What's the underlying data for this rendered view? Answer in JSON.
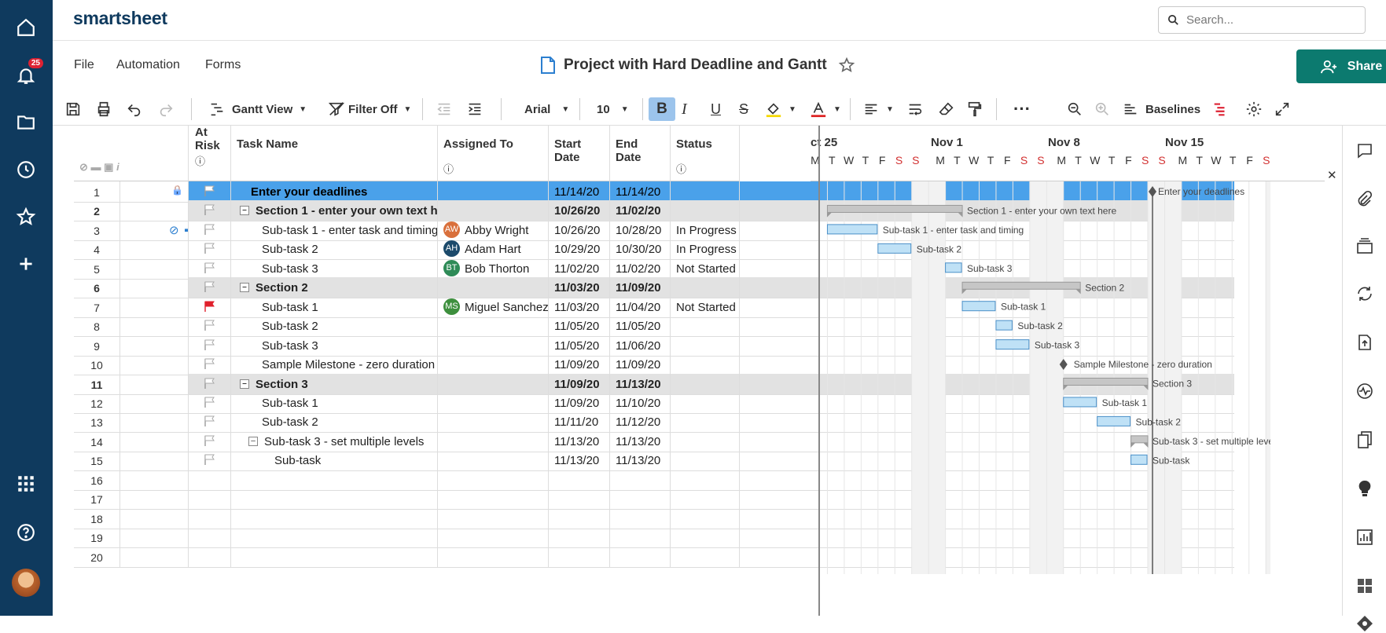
{
  "app": {
    "logo": "smartsheet",
    "notif_count": "25",
    "search_placeholder": "Search..."
  },
  "menu": {
    "file": "File",
    "automation": "Automation",
    "forms": "Forms"
  },
  "doc": {
    "title": "Project with Hard Deadline and Gantt",
    "share": "Share"
  },
  "toolbar": {
    "view": "Gantt View",
    "filter": "Filter Off",
    "font": "Arial",
    "size": "10",
    "baselines": "Baselines"
  },
  "columns": {
    "risk": "At Risk",
    "task": "Task Name",
    "assigned": "Assigned To",
    "start": "Start Date",
    "end": "End Date",
    "status": "Status"
  },
  "gantt": {
    "weeks": [
      "ct 25",
      "Nov 1",
      "Nov 8",
      "Nov 15"
    ],
    "days": [
      "M",
      "T",
      "W",
      "T",
      "F",
      "S",
      "S",
      "M",
      "T",
      "W",
      "T",
      "F",
      "S",
      "S",
      "M",
      "T",
      "W",
      "T",
      "F",
      "S",
      "S",
      "M",
      "T",
      "W",
      "T",
      "F",
      "S"
    ]
  },
  "rows": [
    {
      "n": "1",
      "task": "Enter your deadlines",
      "asg": "",
      "ini": "",
      "st": "11/14/20",
      "en": "11/14/20",
      "stat": "",
      "type": "sel",
      "indent": 0,
      "flag": "white",
      "lock": true
    },
    {
      "n": "2",
      "task": "Section 1 - enter your own text here",
      "asg": "",
      "ini": "",
      "st": "10/26/20",
      "en": "11/02/20",
      "stat": "",
      "type": "sec",
      "indent": 0,
      "flag": "grey"
    },
    {
      "n": "3",
      "task": "Sub-task 1 - enter task and timing",
      "asg": "Abby Wright",
      "ini": "AW",
      "st": "10/26/20",
      "en": "10/28/20",
      "stat": "In Progress",
      "type": "",
      "indent": 1,
      "flag": "grey",
      "icons": true
    },
    {
      "n": "4",
      "task": "Sub-task 2",
      "asg": "Adam Hart",
      "ini": "AH",
      "st": "10/29/20",
      "en": "10/30/20",
      "stat": "In Progress",
      "type": "",
      "indent": 1,
      "flag": "grey"
    },
    {
      "n": "5",
      "task": "Sub-task 3",
      "asg": "Bob Thorton",
      "ini": "BT",
      "st": "11/02/20",
      "en": "11/02/20",
      "stat": "Not Started",
      "type": "",
      "indent": 1,
      "flag": "grey"
    },
    {
      "n": "6",
      "task": "Section 2",
      "asg": "",
      "ini": "",
      "st": "11/03/20",
      "en": "11/09/20",
      "stat": "",
      "type": "sec",
      "indent": 0,
      "flag": "grey"
    },
    {
      "n": "7",
      "task": "Sub-task 1",
      "asg": "Miguel Sanchez",
      "ini": "MS",
      "st": "11/03/20",
      "en": "11/04/20",
      "stat": "Not Started",
      "type": "",
      "indent": 1,
      "flag": "red"
    },
    {
      "n": "8",
      "task": "Sub-task 2",
      "asg": "",
      "ini": "",
      "st": "11/05/20",
      "en": "11/05/20",
      "stat": "",
      "type": "",
      "indent": 1,
      "flag": "grey"
    },
    {
      "n": "9",
      "task": "Sub-task 3",
      "asg": "",
      "ini": "",
      "st": "11/05/20",
      "en": "11/06/20",
      "stat": "",
      "type": "",
      "indent": 1,
      "flag": "grey"
    },
    {
      "n": "10",
      "task": "Sample Milestone - zero duration",
      "asg": "",
      "ini": "",
      "st": "11/09/20",
      "en": "11/09/20",
      "stat": "",
      "type": "",
      "indent": 1,
      "flag": "grey"
    },
    {
      "n": "11",
      "task": "Section 3",
      "asg": "",
      "ini": "",
      "st": "11/09/20",
      "en": "11/13/20",
      "stat": "",
      "type": "sec",
      "indent": 0,
      "flag": "grey"
    },
    {
      "n": "12",
      "task": "Sub-task 1",
      "asg": "",
      "ini": "",
      "st": "11/09/20",
      "en": "11/10/20",
      "stat": "",
      "type": "",
      "indent": 1,
      "flag": "grey"
    },
    {
      "n": "13",
      "task": "Sub-task 2",
      "asg": "",
      "ini": "",
      "st": "11/11/20",
      "en": "11/12/20",
      "stat": "",
      "type": "",
      "indent": 1,
      "flag": "grey"
    },
    {
      "n": "14",
      "task": "Sub-task 3 - set multiple levels",
      "asg": "",
      "ini": "",
      "st": "11/13/20",
      "en": "11/13/20",
      "stat": "",
      "type": "",
      "indent": 1,
      "flag": "grey",
      "collapsible": true
    },
    {
      "n": "15",
      "task": "Sub-task",
      "asg": "",
      "ini": "",
      "st": "11/13/20",
      "en": "11/13/20",
      "stat": "",
      "type": "",
      "indent": 2,
      "flag": "grey"
    },
    {
      "n": "16",
      "task": "",
      "asg": "",
      "ini": "",
      "st": "",
      "en": "",
      "stat": "",
      "type": "",
      "indent": 0,
      "flag": "none"
    },
    {
      "n": "17",
      "task": "",
      "asg": "",
      "ini": "",
      "st": "",
      "en": "",
      "stat": "",
      "type": "",
      "indent": 0,
      "flag": "none"
    },
    {
      "n": "18",
      "task": "",
      "asg": "",
      "ini": "",
      "st": "",
      "en": "",
      "stat": "",
      "type": "",
      "indent": 0,
      "flag": "none"
    },
    {
      "n": "19",
      "task": "",
      "asg": "",
      "ini": "",
      "st": "",
      "en": "",
      "stat": "",
      "type": "",
      "indent": 0,
      "flag": "none"
    },
    {
      "n": "20",
      "task": "",
      "asg": "",
      "ini": "",
      "st": "",
      "en": "",
      "stat": "",
      "type": "",
      "indent": 0,
      "flag": "none"
    }
  ],
  "colors": {
    "nav": "#0f3a5e",
    "selected": "#4aa1ea",
    "section": "#e2e2e2",
    "bar": "#bfe1f6",
    "share": "#0c7a6f",
    "weekend_text": "#d23030",
    "flag_red": "#e0202c",
    "avatar": {
      "AW": "#d9703c",
      "AH": "#1c4a6b",
      "BT": "#2e8b57",
      "MS": "#3d8f3d"
    }
  }
}
